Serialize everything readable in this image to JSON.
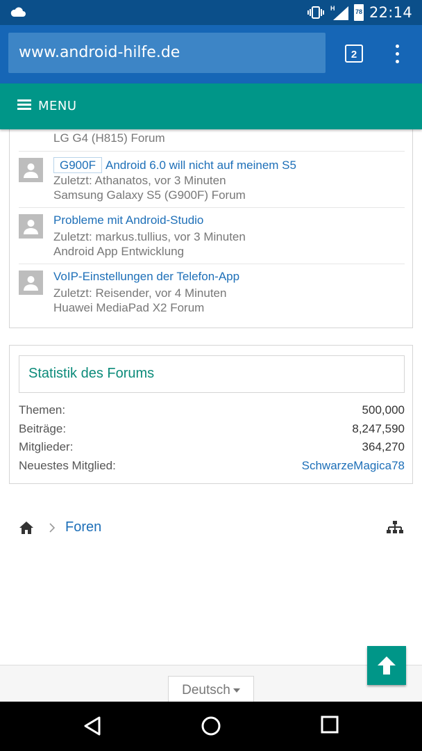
{
  "status_bar": {
    "time": "22:14",
    "network_badge": "H",
    "battery_level": "78",
    "icons": [
      "cloud-icon",
      "vibrate-icon",
      "signal-icon",
      "battery-icon"
    ]
  },
  "browser": {
    "url": "www.android-hilfe.de",
    "tab_count": "2",
    "menu_icon": "more-vert-icon"
  },
  "site_header": {
    "menu_label": "MENU"
  },
  "threads": {
    "partial_forum": "LG G4 (H815) Forum",
    "items": [
      {
        "prefix": "G900F",
        "title": "Android 6.0 will nicht auf meinem S5",
        "last_post": "Zuletzt: Athanatos, vor 3 Minuten",
        "forum": "Samsung Galaxy S5 (G900F) Forum"
      },
      {
        "prefix": "",
        "title": "Probleme mit Android-Studio",
        "last_post": "Zuletzt: markus.tullius, vor 3 Minuten",
        "forum": "Android App Entwicklung"
      },
      {
        "prefix": "",
        "title": "VoIP-Einstellungen der Telefon-App",
        "last_post": "Zuletzt: Reisender, vor 4 Minuten",
        "forum": "Huawei MediaPad X2 Forum"
      }
    ]
  },
  "stats": {
    "title": "Statistik des Forums",
    "rows": [
      {
        "label": "Themen:",
        "value": "500,000"
      },
      {
        "label": "Beiträge:",
        "value": "8,247,590"
      },
      {
        "label": "Mitglieder:",
        "value": "364,270"
      },
      {
        "label": "Neuestes Mitglied:",
        "value": "SchwarzeMagica78"
      }
    ]
  },
  "breadcrumb": {
    "link": "Foren"
  },
  "footer": {
    "language": "Deutsch"
  },
  "colors": {
    "status_bar": "#0b4f8a",
    "browser_bar": "#1666b6",
    "accent_teal": "#009688",
    "link_blue": "#1d6fb8"
  }
}
